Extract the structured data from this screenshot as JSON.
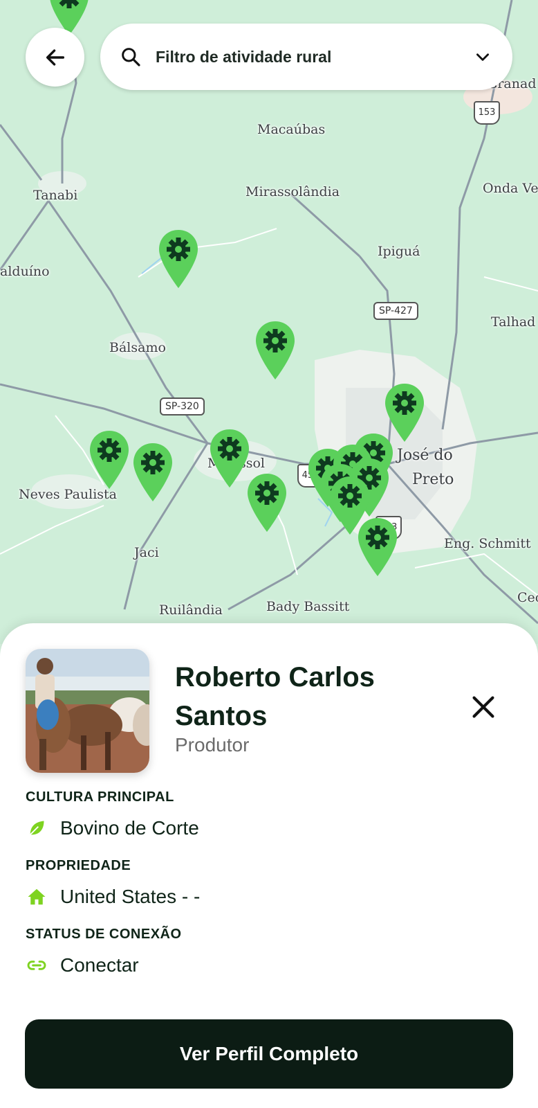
{
  "map": {
    "places": [
      {
        "name": "Macaúbas"
      },
      {
        "name": "Tanabi"
      },
      {
        "name": "Mirassolândia"
      },
      {
        "name": "Onda Ve"
      },
      {
        "name": "Ipiguá"
      },
      {
        "name": "alduíno"
      },
      {
        "name": "Talhad"
      },
      {
        "name": "Bálsamo"
      },
      {
        "name": "José do"
      },
      {
        "name": "Preto"
      },
      {
        "name": "Mirassol"
      },
      {
        "name": "Neves Paulista"
      },
      {
        "name": "Jaci"
      },
      {
        "name": "Eng. Schmitt"
      },
      {
        "name": "Bady Bassitt"
      },
      {
        "name": "Ruilândia"
      },
      {
        "name": "Nova Granad"
      },
      {
        "name": "Cec"
      }
    ],
    "roads": {
      "sp427": "SP-427",
      "sp320": "SP-320",
      "r153a": "153",
      "r153b": "153",
      "r456": "456"
    },
    "pin_color": "#5bd05b",
    "pin_icon": "gear-icon"
  },
  "header": {
    "search_placeholder": "Filtro de atividade rural"
  },
  "profile": {
    "name": "Roberto Carlos Santos",
    "role": "Produtor",
    "sections": {
      "culture_title": "CULTURA PRINCIPAL",
      "culture_value": "Bovino de Corte",
      "property_title": "PROPRIEDADE",
      "property_value": "United States - -",
      "status_title": "STATUS DE CONEXÃO",
      "status_value": "Conectar"
    },
    "cta_label": "Ver Perfil Completo"
  },
  "colors": {
    "accent": "#7ed321",
    "dark": "#0c1c14"
  }
}
